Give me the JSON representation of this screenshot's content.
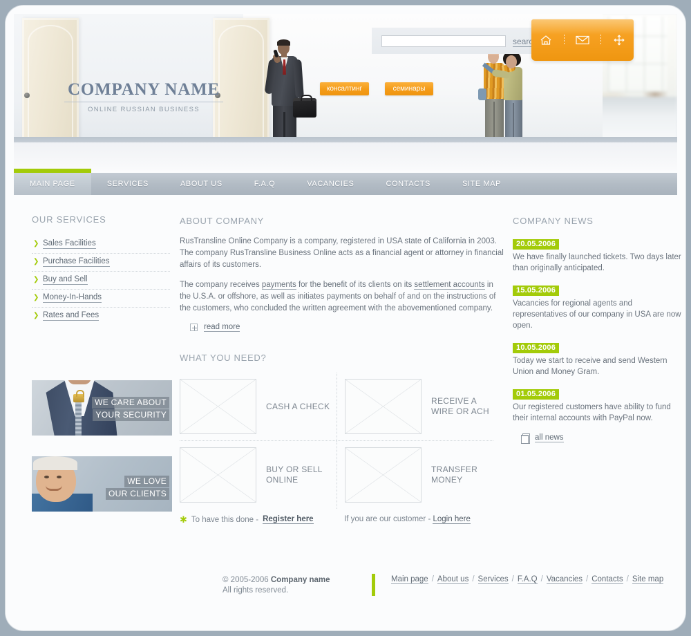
{
  "brand": {
    "name": "COMPANY NAME",
    "tagline": "ONLINE RUSSIAN BUSINESS"
  },
  "colors": {
    "accent_green": "#a3cb09",
    "accent_orange": "#f6a021",
    "page_bg": "#9fadb9",
    "nav_bg": "#b3bcc5",
    "text_gray": "#6b747e"
  },
  "search": {
    "value": "",
    "placeholder": "",
    "button_label": "search"
  },
  "header": {
    "pills": [
      {
        "label": "консалтинг"
      },
      {
        "label": "семинары"
      }
    ],
    "icons": [
      {
        "name": "home-icon",
        "title": "home"
      },
      {
        "name": "mail-icon",
        "title": "mail"
      },
      {
        "name": "sitemap-icon",
        "title": "site map"
      }
    ]
  },
  "nav": {
    "items": [
      {
        "label": "MAIN PAGE",
        "active": true
      },
      {
        "label": "SERVICES",
        "active": false
      },
      {
        "label": "ABOUT US",
        "active": false
      },
      {
        "label": "F.A.Q",
        "active": false
      },
      {
        "label": "VACANCIES",
        "active": false
      },
      {
        "label": "CONTACTS",
        "active": false
      },
      {
        "label": "SITE MAP",
        "active": false
      }
    ]
  },
  "sidebar": {
    "title": "OUR SERVICES",
    "items": [
      {
        "label": "Sales Facilities"
      },
      {
        "label": "Purchase Facilities"
      },
      {
        "label": "Buy and Sell"
      },
      {
        "label": "Money-In-Hands"
      },
      {
        "label": "Rates and Fees"
      }
    ],
    "promos": [
      {
        "line1": "WE CARE ABOUT",
        "line2": "YOUR SECURITY"
      },
      {
        "line1": "WE LOVE",
        "line2": "OUR CLIENTS"
      }
    ]
  },
  "about": {
    "title": "ABOUT COMPANY",
    "p1_a": "RusTransline Online Company  is a company, registered in USA state of California in 2003. The company RusTransline Business Online acts as a financial agent or attorney in financial affairs of its customers.",
    "p2_a": "The company receives ",
    "p2_link1": "payments",
    "p2_b": " for the benefit of its clients on its ",
    "p2_link2": "settlement accounts",
    "p2_c": " in the U.S.A. or offshore, as well as initiates payments on behalf of and on the instructions of the customers, who concluded the written agreement with the abovementioned company.",
    "read_more": "read more"
  },
  "need": {
    "title": "WHAT YOU NEED?",
    "cells": [
      {
        "label": "CASH A CHECK"
      },
      {
        "label": "RECEIVE A WIRE OR ACH"
      },
      {
        "label": "BUY OR SELL ONLINE"
      },
      {
        "label": "TRANSFER MONEY"
      }
    ],
    "footer_left_text": "To have this done -",
    "footer_left_link": "Register here",
    "footer_right_text": "If you are our customer -",
    "footer_right_link": "Login here"
  },
  "news": {
    "title": "COMPANY NEWS",
    "items": [
      {
        "date": "20.05.2006",
        "text": "We have finally launched tickets. Two days later than originally anticipated."
      },
      {
        "date": "15.05.2006",
        "text": "Vacancies for regional agents and representatives of our company in USA are now open."
      },
      {
        "date": "10.05.2006",
        "text": "Today we start to receive and send Western Union and Money Gram."
      },
      {
        "date": "01.05.2006",
        "text": "Our registered customers have ability to fund their internal accounts with PayPal now."
      }
    ],
    "all_news": "all news"
  },
  "footer": {
    "copyright_prefix": "© 2005-2006 ",
    "copyright_company": "Company name",
    "rights": "All rights reserved.",
    "links": [
      {
        "label": "Main page"
      },
      {
        "label": "About us"
      },
      {
        "label": "Services"
      },
      {
        "label": "F.A.Q"
      },
      {
        "label": "Vacancies"
      },
      {
        "label": "Contacts"
      },
      {
        "label": "Site map"
      }
    ],
    "separator": "/"
  }
}
